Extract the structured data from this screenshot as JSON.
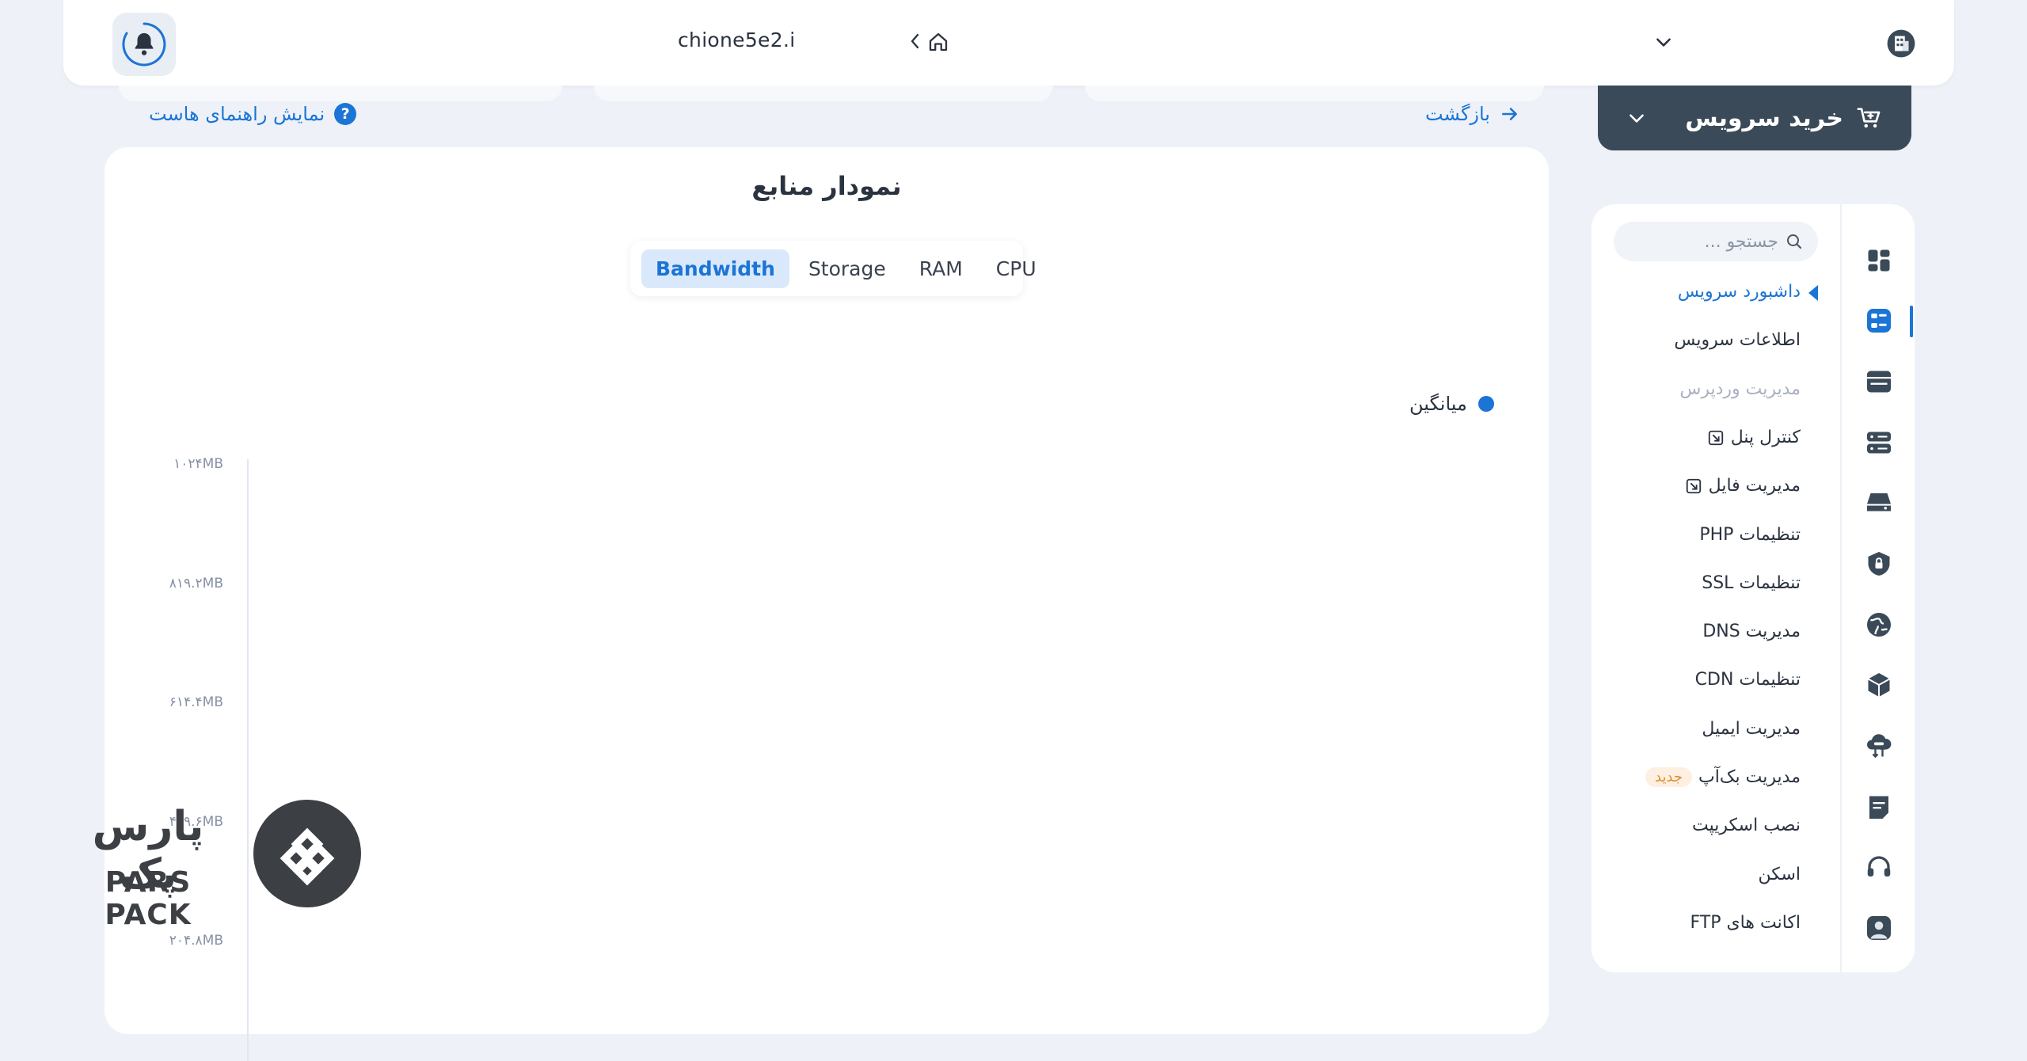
{
  "topbar": {
    "domain": "chione5e2.i",
    "icons": [
      "bell-icon",
      "chevron-left-icon",
      "home-icon",
      "chevron-down-icon",
      "building-icon"
    ]
  },
  "actions": {
    "back_label": "بازگشت",
    "guide_label": "نمایش راهنمای هاست",
    "guide_icon_glyph": "?",
    "buy_label": "خرید سرویس"
  },
  "chart": {
    "title": "نمودار منابع",
    "tabs": [
      {
        "label": "Bandwidth",
        "active": true
      },
      {
        "label": "Storage",
        "active": false
      },
      {
        "label": "RAM",
        "active": false
      },
      {
        "label": "CPU",
        "active": false
      }
    ],
    "legend_label": "میانگین",
    "accent_color": "#1b74d6"
  },
  "chart_data": {
    "type": "line",
    "title": "نمودار منابع",
    "series": [
      {
        "name": "میانگین",
        "values": []
      }
    ],
    "y_ticks": [
      "۱۰۲۴MB",
      "۸۱۹.۲MB",
      "۶۱۴.۴MB",
      "۴۰۹.۶MB",
      "۲۰۴.۸MB"
    ],
    "ylim": [
      0,
      1024
    ],
    "xlabel": "",
    "ylabel": ""
  },
  "sidebar": {
    "search_placeholder": "جستجو ...",
    "items": [
      {
        "label": "داشبورد سرویس",
        "state": "active"
      },
      {
        "label": "اطلاعات سرویس",
        "state": "normal"
      },
      {
        "label": "مدیریت وردپرس",
        "state": "muted"
      },
      {
        "label": "کنترل پنل",
        "state": "normal",
        "external": true
      },
      {
        "label": "مدیریت فایل",
        "state": "normal",
        "external": true
      },
      {
        "label": "تنظیمات PHP",
        "state": "normal"
      },
      {
        "label": "تنظیمات SSL",
        "state": "normal"
      },
      {
        "label": "مدیریت DNS",
        "state": "normal"
      },
      {
        "label": "تنظیمات CDN",
        "state": "normal"
      },
      {
        "label": "مدیریت ایمیل",
        "state": "normal"
      },
      {
        "label": "مدیریت بک‌آپ",
        "state": "normal",
        "badge": "جدید"
      },
      {
        "label": "نصب اسکریپت",
        "state": "normal"
      },
      {
        "label": "اسکن",
        "state": "normal"
      },
      {
        "label": "اکانت های FTP",
        "state": "normal"
      }
    ],
    "rail_icons": [
      "dashboard-icon",
      "service-icon",
      "web-icon",
      "server-icon",
      "storage-icon",
      "shield-icon",
      "globe-icon",
      "box-icon",
      "cloud-transfer-icon",
      "note-icon",
      "headset-icon",
      "user-icon"
    ]
  },
  "watermark": {
    "text_fa": "پارس پک",
    "text_en": "PARS PACK"
  }
}
